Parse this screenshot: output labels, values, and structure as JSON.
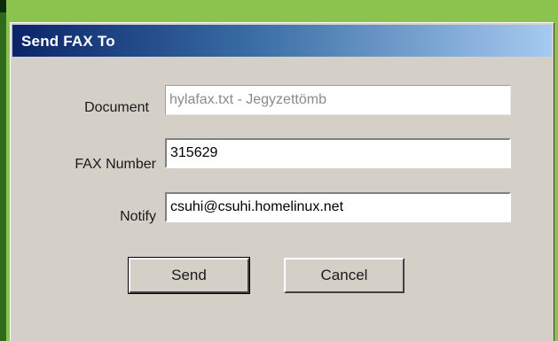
{
  "window": {
    "title": "Send FAX To"
  },
  "form": {
    "document": {
      "label": "Document",
      "value": "hylafax.txt - Jegyzettömb"
    },
    "fax_number": {
      "label": "FAX Number",
      "value": "315629"
    },
    "notify": {
      "label": "Notify",
      "value": "csuhi@csuhi.homelinux.net"
    }
  },
  "buttons": {
    "send": "Send",
    "cancel": "Cancel"
  },
  "colors": {
    "background_green": "#8cc24e",
    "dialog_face": "#d4d0c8",
    "title_gradient_start": "#0a246a",
    "title_gradient_end": "#a6caf0"
  }
}
